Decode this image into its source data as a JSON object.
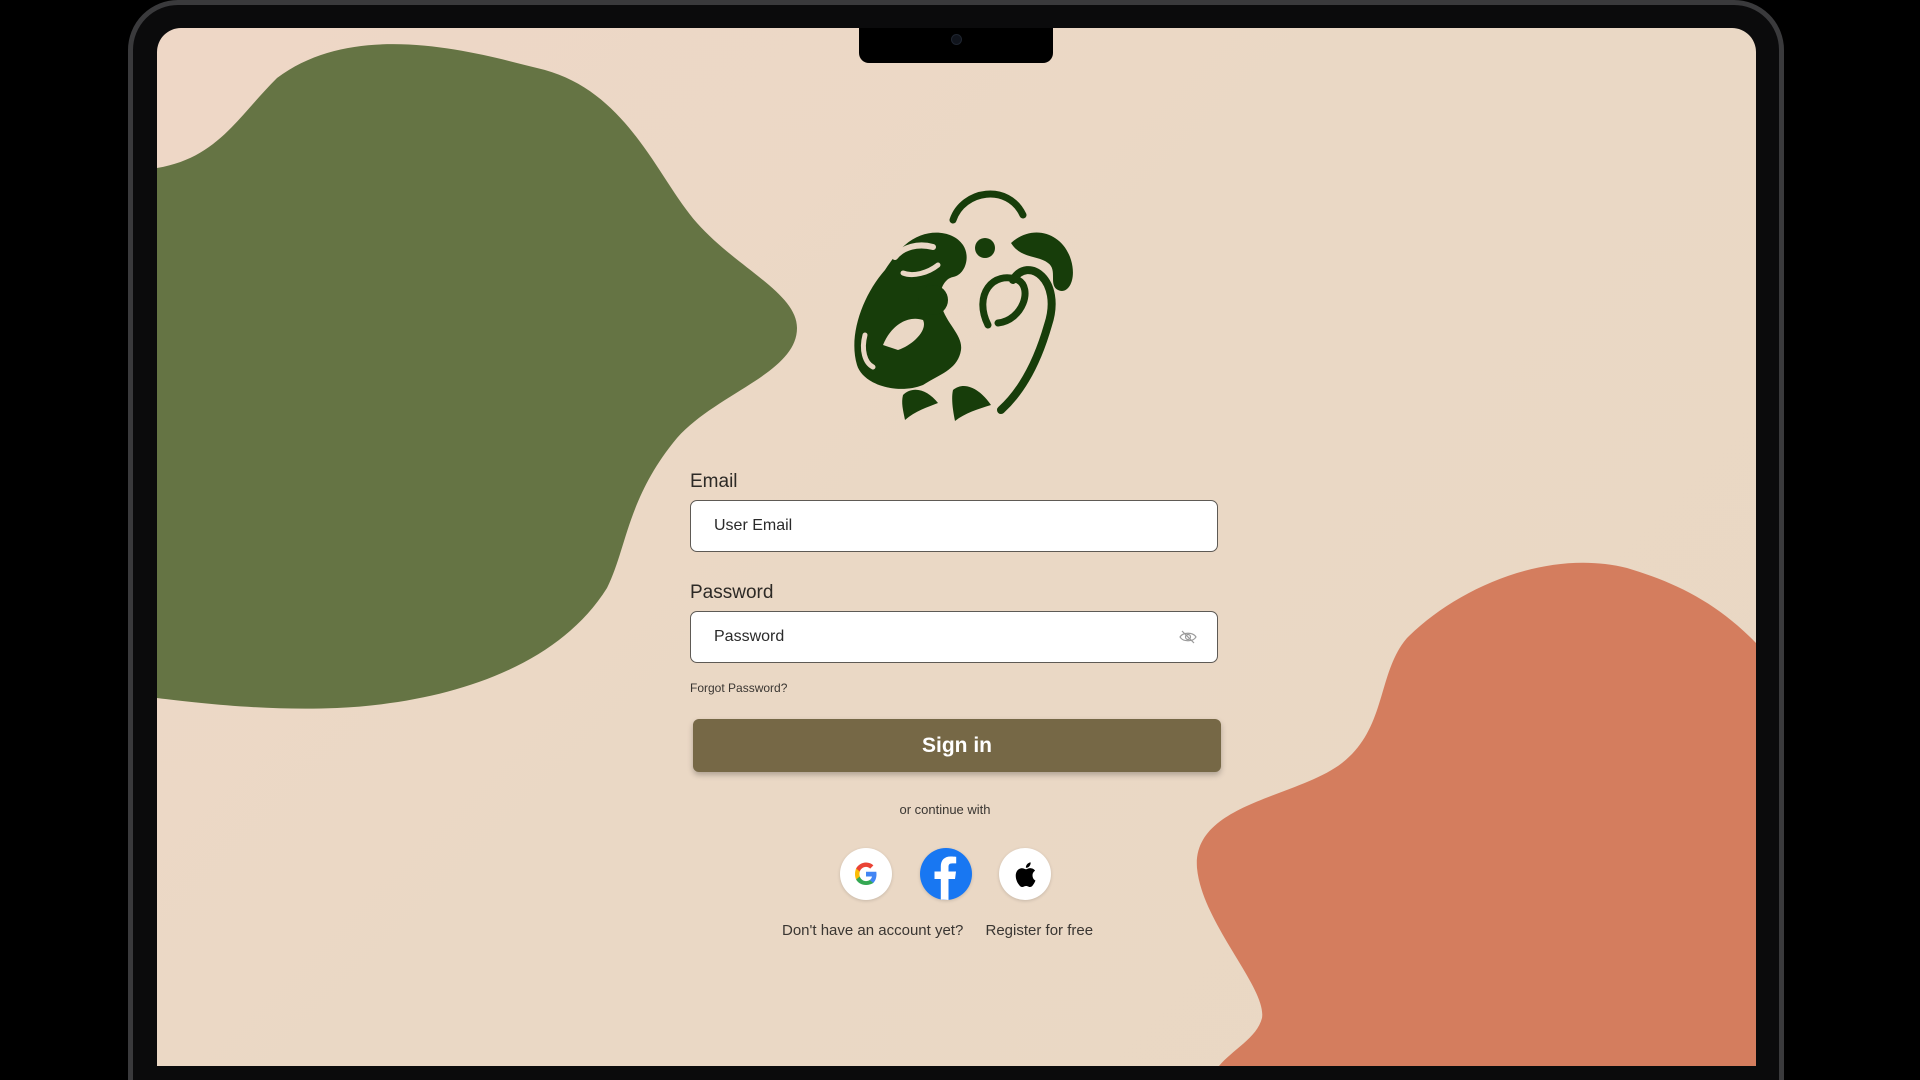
{
  "colors": {
    "background": "#ead7c5",
    "green_blob": "#657444",
    "orange_blob": "#d47d5e",
    "logo": "#173d0a",
    "signin_button": "#766846",
    "facebook": "#1877f2"
  },
  "logo": {
    "icon": "parrot-logo-icon"
  },
  "form": {
    "email": {
      "label": "Email",
      "placeholder": "User Email"
    },
    "password": {
      "label": "Password",
      "placeholder": "Password",
      "toggle_icon": "eye-slash-icon"
    },
    "forgot_password": "Forgot Password?",
    "signin_label": "Sign in"
  },
  "social": {
    "divider_text": "or continue with",
    "providers": [
      {
        "name": "Google",
        "icon": "google-icon"
      },
      {
        "name": "Facebook",
        "icon": "facebook-icon"
      },
      {
        "name": "Apple",
        "icon": "apple-icon"
      }
    ]
  },
  "register": {
    "prompt": "Don't have an account yet?",
    "link": "Register for free"
  }
}
